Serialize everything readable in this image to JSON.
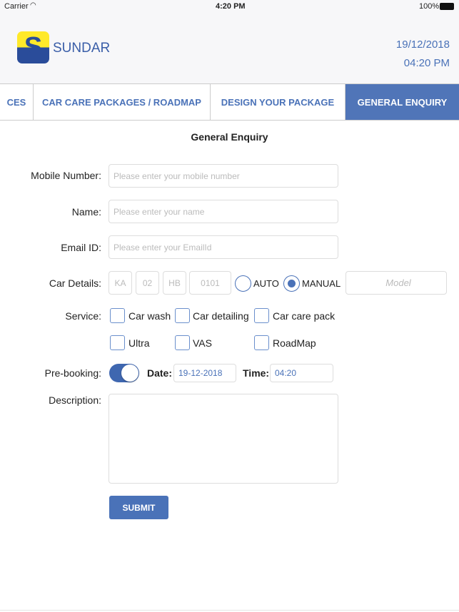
{
  "status": {
    "carrier": "Carrier",
    "time": "4:20 PM",
    "battery": "100%"
  },
  "header": {
    "brand": "SUNDAR",
    "date": "19/12/2018",
    "time": "04:20 PM",
    "accent": "#4a72b8"
  },
  "tabs": [
    {
      "label": "CES"
    },
    {
      "label": "CAR CARE PACKAGES / ROADMAP"
    },
    {
      "label": "DESIGN YOUR PACKAGE"
    },
    {
      "label": "GENERAL ENQUIRY",
      "active": true
    }
  ],
  "form": {
    "title": "General Enquiry",
    "mobile": {
      "label": "Mobile Number:",
      "placeholder": "Please enter your mobile number"
    },
    "name": {
      "label": "Name:",
      "placeholder": "Please enter your name"
    },
    "email": {
      "label": "Email ID:",
      "placeholder": "Please enter your EmailId"
    },
    "car": {
      "label": "Car Details:",
      "parts": [
        "KA",
        "02",
        "HB",
        "0101"
      ],
      "auto": "AUTO",
      "manual": "MANUAL",
      "selected": "MANUAL",
      "model_placeholder": "Model"
    },
    "service": {
      "label": "Service:",
      "options": [
        "Car wash",
        "Car detailing",
        "Car care pack",
        "Ultra",
        "VAS",
        "RoadMap"
      ]
    },
    "prebooking": {
      "label": "Pre-booking:",
      "on": true,
      "date_label": "Date:",
      "date": "19-12-2018",
      "time_label": "Time:",
      "time": "04:20"
    },
    "description": {
      "label": "Description:"
    },
    "submit": "SUBMIT"
  }
}
